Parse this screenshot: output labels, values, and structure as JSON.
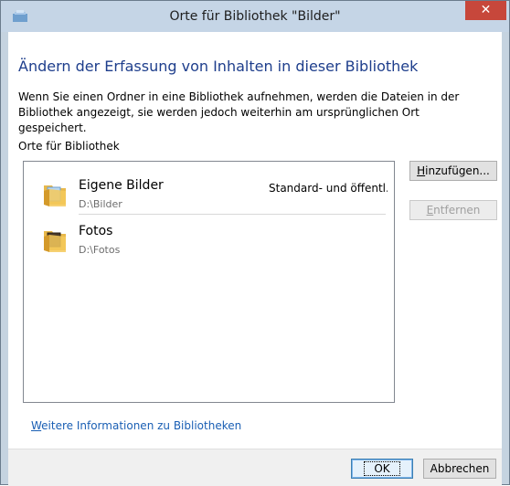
{
  "window": {
    "title": "Orte für Bibliothek \"Bilder\"",
    "close_glyph": "✕"
  },
  "main": {
    "heading": "Ändern der Erfassung von Inhalten in dieser Bibliothek",
    "description": "Wenn Sie einen Ordner in eine Bibliothek aufnehmen, werden die Dateien in der Bibliothek angezeigt, sie werden jedoch weiterhin am ursprünglichen Ort gespeichert.",
    "list_caption": "Orte für Bibliothek",
    "locations": [
      {
        "name": "Eigene Bilder",
        "path": "D:\\Bilder",
        "status": "Standard- und öffentl...",
        "icon": "pictures-folder-icon"
      },
      {
        "name": "Fotos",
        "path": "D:\\Fotos",
        "status": "",
        "icon": "pictures-folder-icon"
      }
    ],
    "add_button": {
      "accel": "H",
      "rest": "inzufügen..."
    },
    "remove_button": {
      "accel": "E",
      "rest": "ntfernen"
    },
    "more_info": {
      "accel": "W",
      "rest": "eitere Informationen zu Bibliotheken"
    }
  },
  "footer": {
    "ok_label": "OK",
    "cancel_label": "Abbrechen"
  },
  "colors": {
    "heading": "#1e3e8c",
    "link": "#1a5fb4",
    "close_button": "#c7473b",
    "title_bar": "#c5d5e6"
  }
}
